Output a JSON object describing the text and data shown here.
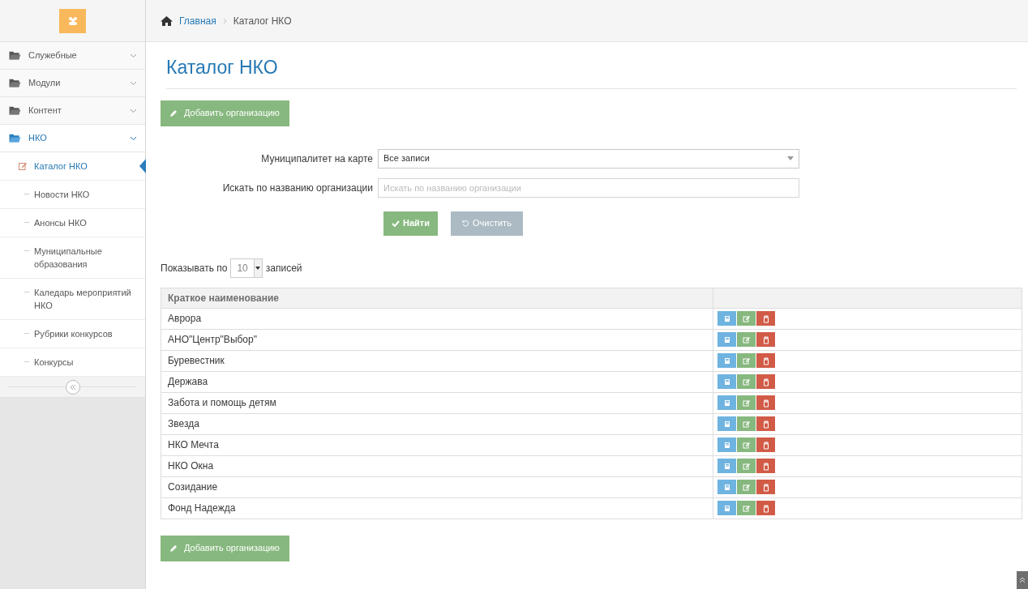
{
  "breadcrumb": [
    {
      "label": "Главная",
      "kind": "home"
    },
    {
      "label": "Каталог НКО",
      "kind": "current"
    }
  ],
  "sidebar": {
    "items": [
      {
        "label": "Служебные",
        "expanded": false
      },
      {
        "label": "Модули",
        "expanded": false
      },
      {
        "label": "Контент",
        "expanded": false
      },
      {
        "label": "НКО",
        "expanded": true,
        "children": [
          {
            "label": "Каталог НКО",
            "selected": true
          },
          {
            "label": "Новости НКО",
            "selected": false
          },
          {
            "label": "Анонсы НКО",
            "selected": false
          },
          {
            "label": "Муниципальные образования",
            "selected": false
          },
          {
            "label": "Каледарь мероприятий НКО",
            "selected": false
          },
          {
            "label": "Рубрики конкурсов",
            "selected": false
          },
          {
            "label": "Конкурсы",
            "selected": false
          }
        ]
      }
    ]
  },
  "page_title": "Каталог НКО",
  "add_button": "Добавить организацию",
  "filters": [
    {
      "label": "Муниципалитет на карте",
      "kind": "select",
      "value": "Все записи"
    },
    {
      "label": "Искать по названию организации",
      "kind": "text",
      "placeholder": "Искать по названию организации"
    }
  ],
  "search_button": "Найти",
  "clear_button": "Очистить",
  "page_size": {
    "before": "Показывать по",
    "value": "10",
    "after": "записей"
  },
  "table": {
    "columns": [
      "Краткое наименование"
    ],
    "rows": [
      "Аврора",
      "АНО\"Центр\"Выбор\"",
      "Буревестник",
      "Держава",
      "Забота и помощь детям",
      "Звезда",
      "НКО Мечта",
      "НКО Окна",
      "Созидание",
      "Фонд Надежда"
    ]
  },
  "bottom_add_button": "Добавить организацию"
}
